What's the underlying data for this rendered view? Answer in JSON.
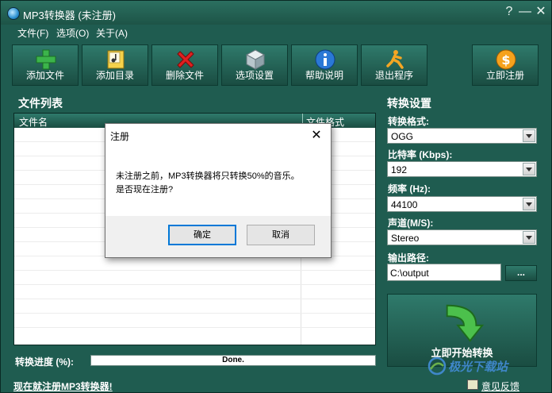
{
  "window": {
    "title": "MP3转换器 (未注册)",
    "controls": {
      "help": "?",
      "minimize": "—",
      "close": "✕"
    }
  },
  "menu": [
    "文件(F)",
    "选项(O)",
    "关于(A)"
  ],
  "toolbar": {
    "add_file": "添加文件",
    "add_folder": "添加目录",
    "delete_file": "删除文件",
    "options": "选项设置",
    "help": "帮助说明",
    "exit": "退出程序",
    "register": "立即注册"
  },
  "file_list": {
    "title": "文件列表",
    "columns": [
      "文件名",
      "文件格式"
    ]
  },
  "settings": {
    "title": "转换设置",
    "format_label": "转换格式:",
    "format_value": "OGG",
    "bitrate_label": "比特率 (Kbps):",
    "bitrate_value": "192",
    "freq_label": "频率 (Hz):",
    "freq_value": "44100",
    "channel_label": "声道(M/S):",
    "channel_value": "Stereo",
    "output_label": "输出路径:",
    "output_value": "C:\\output",
    "browse": "..."
  },
  "start_button": "立即开始转换",
  "progress": {
    "label": "转换进度 (%):",
    "text": "Done."
  },
  "statusbar": {
    "register_link": "现在就注册MP3转换器!",
    "feedback": "意见反馈"
  },
  "dialog": {
    "title": "注册",
    "close": "✕",
    "message_line1": "未注册之前，MP3转换器将只转换50%的音乐。",
    "message_line2": "是否现在注册?",
    "ok": "确定",
    "cancel": "取消"
  },
  "watermark": "极光下载站",
  "colors": {
    "window_bg": "#1f5c50",
    "accent_green": "#3cb44b",
    "dialog_focus": "#0078d7"
  }
}
